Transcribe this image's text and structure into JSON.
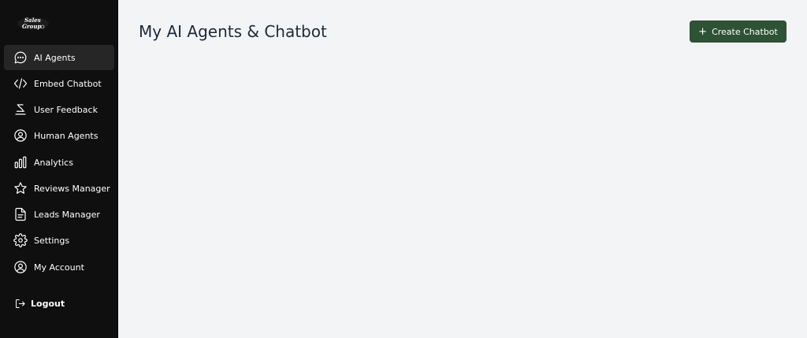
{
  "sidebar": {
    "logo_text": "Sales Group",
    "items": [
      {
        "label": "AI Agents",
        "icon": "chat-bubble-icon",
        "active": true
      },
      {
        "label": "Embed Chatbot",
        "icon": "code-icon"
      },
      {
        "label": "User Feedback",
        "icon": "feedback-icon"
      },
      {
        "label": "Human Agents",
        "icon": "user-circle-icon"
      },
      {
        "label": "Analytics",
        "icon": "bar-chart-icon"
      },
      {
        "label": "Reviews Manager",
        "icon": "star-icon"
      },
      {
        "label": "Leads Manager",
        "icon": "document-icon"
      },
      {
        "label": "Settings",
        "icon": "gear-icon"
      },
      {
        "label": "My Account",
        "icon": "account-icon"
      }
    ],
    "logout_label": "Logout"
  },
  "main": {
    "title": "My AI Agents & Chatbot",
    "create_button_label": "Create Chatbot"
  },
  "colors": {
    "sidebar_bg": "#0f0f0f",
    "active_item_bg": "#262626",
    "main_bg": "#f3f4f6",
    "accent": "#2e5235"
  }
}
